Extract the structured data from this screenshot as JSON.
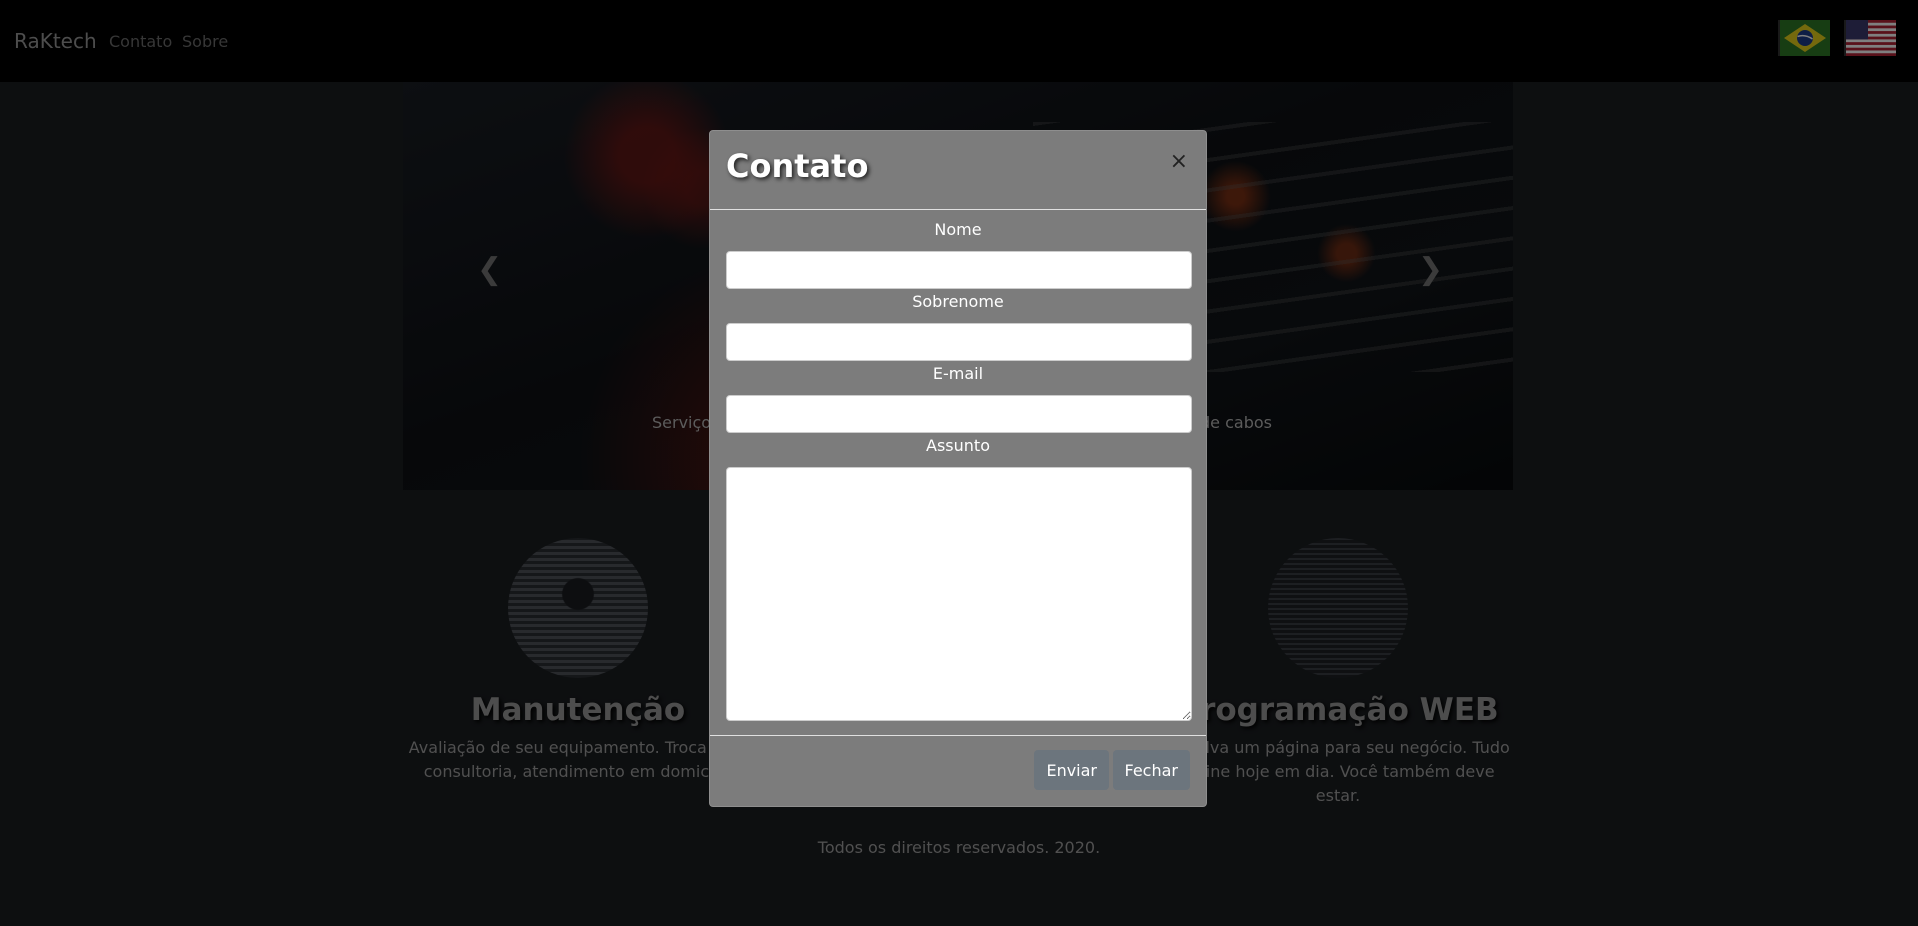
{
  "navbar": {
    "brand": "RaKtech",
    "links": [
      "Contato",
      "Sobre"
    ]
  },
  "hero": {
    "caption_left": "Serviços",
    "caption_right": "de cabos"
  },
  "features": [
    {
      "title": "Manutenção",
      "text_line1": "Avaliação de seu equipamento. Troca de p",
      "text_line2": "consultoria, atendimento em domicílio"
    },
    {
      "title": "Programação WEB",
      "text_line1": "envolva um página para seu negócio. Tudo",
      "text_line2": "online hoje em dia. Você também deve estar."
    }
  ],
  "footer": "Todos os direitos reservados. 2020.",
  "modal": {
    "title": "Contato",
    "close_glyph": "×",
    "fields": {
      "nome": "Nome",
      "sobrenome": "Sobrenome",
      "email": "E-mail",
      "assunto": "Assunto"
    },
    "buttons": {
      "send": "Enviar",
      "close": "Fechar"
    }
  },
  "colors": {
    "modal_bg": "#7c7c7c",
    "button_bg": "#6c757d",
    "page_bg": "#1b1e21"
  },
  "icons": {
    "flag_br": "brazil-flag-icon",
    "flag_us": "usa-flag-icon",
    "prev": "chevron-left-icon",
    "next": "chevron-right-icon"
  }
}
